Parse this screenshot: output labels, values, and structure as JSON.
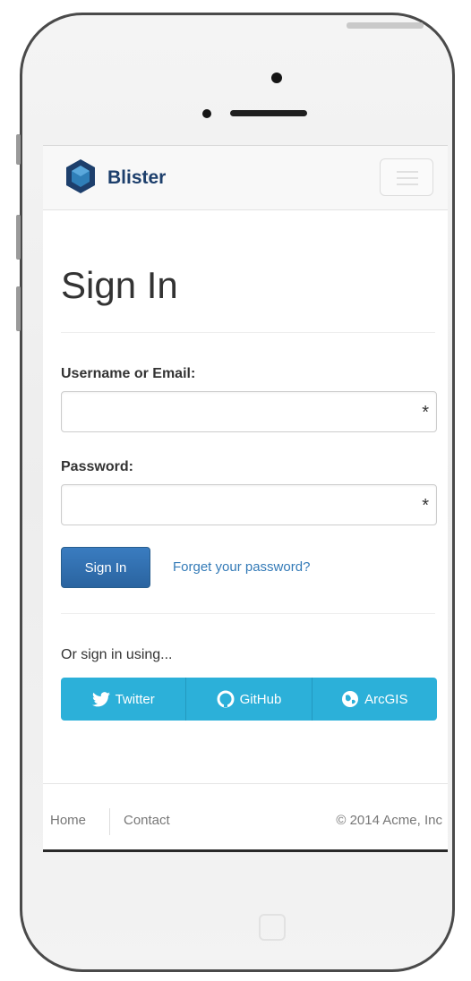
{
  "navbar": {
    "brand": "Blister",
    "menu_icon": "hamburger-icon"
  },
  "page": {
    "title": "Sign In"
  },
  "form": {
    "username_label": "Username or Email:",
    "username_value": "",
    "username_required_marker": "*",
    "password_label": "Password:",
    "password_value": "",
    "password_required_marker": "*",
    "submit_label": "Sign In",
    "forgot_link": "Forget your password?"
  },
  "social": {
    "intro": "Or sign in using...",
    "buttons": [
      {
        "label": "Twitter",
        "icon": "twitter-icon"
      },
      {
        "label": "GitHub",
        "icon": "github-icon"
      },
      {
        "label": "ArcGIS",
        "icon": "globe-icon"
      }
    ]
  },
  "footer": {
    "links": [
      "Home",
      "Contact"
    ],
    "copyright": "© 2014 Acme, Inc"
  },
  "colors": {
    "brand": "#1d3f6c",
    "primary_button": "#2e6da4",
    "link": "#337ab7",
    "social_button": "#2cb0d9"
  }
}
